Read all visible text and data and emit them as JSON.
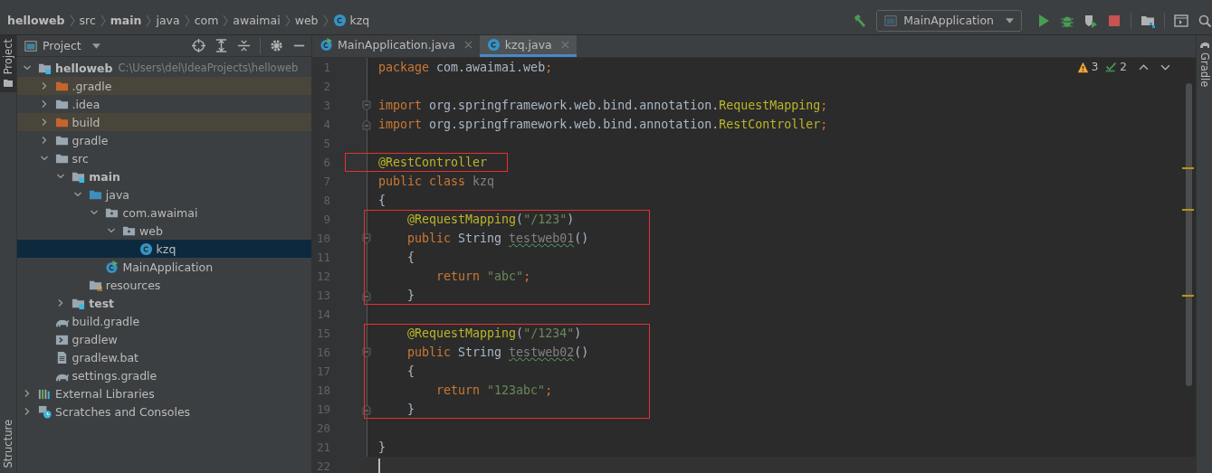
{
  "breadcrumb": [
    {
      "label": "helloweb",
      "bold": true,
      "kind": "folder"
    },
    {
      "label": "src",
      "bold": false,
      "kind": "folder"
    },
    {
      "label": "main",
      "bold": true,
      "kind": "folder"
    },
    {
      "label": "java",
      "bold": false,
      "kind": "folder"
    },
    {
      "label": "com",
      "bold": false,
      "kind": "folder"
    },
    {
      "label": "awaimai",
      "bold": false,
      "kind": "folder"
    },
    {
      "label": "web",
      "bold": false,
      "kind": "folder"
    },
    {
      "label": "kzq",
      "bold": false,
      "kind": "class"
    }
  ],
  "run_config": {
    "label": "MainApplication"
  },
  "side_tabs_left": [
    {
      "label": "Project",
      "selected": true
    },
    {
      "label": "Structure",
      "selected": false
    }
  ],
  "side_tabs_right": [
    {
      "label": "Gradle",
      "selected": false
    }
  ],
  "project_panel": {
    "title": "Project",
    "tree": [
      {
        "label": "helloweb",
        "path": "C:\\Users\\del\\IdeaProjects\\helloweb",
        "kind": "module",
        "bold": true,
        "expanded": true,
        "excluded": false,
        "selected": false,
        "children": [
          {
            "label": ".gradle",
            "kind": "excluded-folder",
            "bold": false,
            "expanded": false,
            "excluded": true,
            "selected": false
          },
          {
            "label": ".idea",
            "kind": "folder",
            "bold": false,
            "expanded": false,
            "excluded": false,
            "selected": false
          },
          {
            "label": "build",
            "kind": "excluded-folder",
            "bold": false,
            "expanded": false,
            "excluded": true,
            "selected": false
          },
          {
            "label": "gradle",
            "kind": "folder",
            "bold": false,
            "expanded": false,
            "excluded": false,
            "selected": false
          },
          {
            "label": "src",
            "kind": "folder",
            "bold": false,
            "expanded": true,
            "excluded": false,
            "selected": false,
            "children": [
              {
                "label": "main",
                "kind": "module",
                "bold": true,
                "expanded": true,
                "excluded": false,
                "selected": false,
                "children": [
                  {
                    "label": "java",
                    "kind": "source-folder",
                    "bold": false,
                    "expanded": true,
                    "excluded": false,
                    "selected": false,
                    "children": [
                      {
                        "label": "com.awaimai",
                        "kind": "package",
                        "bold": false,
                        "expanded": true,
                        "excluded": false,
                        "selected": false,
                        "children": [
                          {
                            "label": "web",
                            "kind": "package",
                            "bold": false,
                            "expanded": true,
                            "excluded": false,
                            "selected": false,
                            "children": [
                              {
                                "label": "kzq",
                                "kind": "class",
                                "bold": false,
                                "excluded": false,
                                "selected": true
                              }
                            ]
                          }
                        ]
                      },
                      {
                        "label": "MainApplication",
                        "kind": "main-class",
                        "bold": false,
                        "excluded": false,
                        "selected": false
                      }
                    ]
                  },
                  {
                    "label": "resources",
                    "kind": "resources-folder",
                    "bold": false,
                    "excluded": false,
                    "selected": false
                  }
                ]
              },
              {
                "label": "test",
                "kind": "module",
                "bold": true,
                "expanded": false,
                "excluded": false,
                "selected": false
              }
            ]
          },
          {
            "label": "build.gradle",
            "kind": "gradle",
            "bold": false,
            "excluded": false,
            "selected": false
          },
          {
            "label": "gradlew",
            "kind": "script",
            "bold": false,
            "excluded": false,
            "selected": false
          },
          {
            "label": "gradlew.bat",
            "kind": "text-file",
            "bold": false,
            "excluded": false,
            "selected": false
          },
          {
            "label": "settings.gradle",
            "kind": "gradle",
            "bold": false,
            "excluded": false,
            "selected": false
          }
        ]
      },
      {
        "label": "External Libraries",
        "kind": "libraries",
        "bold": false,
        "expanded": false,
        "excluded": false,
        "selected": false
      },
      {
        "label": "Scratches and Consoles",
        "kind": "scratches",
        "bold": false,
        "expanded": false,
        "excluded": false,
        "selected": false
      }
    ]
  },
  "editor_tabs": [
    {
      "label": "MainApplication.java",
      "kind": "main-class",
      "selected": false
    },
    {
      "label": "kzq.java",
      "kind": "class",
      "selected": true
    }
  ],
  "inspections": {
    "warnings": "3",
    "typos": "2"
  },
  "code_blocks": [
    {
      "framed": false,
      "lines": [
        {
          "no": "1",
          "kind": "code",
          "current": false,
          "tokens": [
            {
              "kind": "keyword",
              "text": "package"
            },
            {
              "kind": "plain",
              "text": " com.awaimai.web"
            },
            {
              "kind": "keyword",
              "text": ";"
            }
          ]
        },
        {
          "no": "2",
          "kind": "code",
          "current": false
        },
        {
          "no": "3",
          "kind": "fold-start",
          "current": false,
          "tokens": [
            {
              "kind": "keyword",
              "text": "import"
            },
            {
              "kind": "plain",
              "text": " org.springframework.web.bind.annotation."
            },
            {
              "kind": "annotation",
              "text": "RequestMapping"
            },
            {
              "kind": "keyword",
              "text": ";"
            }
          ]
        },
        {
          "no": "4",
          "kind": "fold-end",
          "current": false,
          "tokens": [
            {
              "kind": "keyword",
              "text": "import"
            },
            {
              "kind": "plain",
              "text": " org.springframework.web.bind.annotation."
            },
            {
              "kind": "annotation",
              "text": "RestController"
            },
            {
              "kind": "keyword",
              "text": ";"
            }
          ]
        },
        {
          "no": "5",
          "kind": "code",
          "current": false
        }
      ]
    },
    {
      "framed": true,
      "lines": [
        {
          "no": "6",
          "kind": "code",
          "current": false,
          "tokens": [
            {
              "kind": "annotation",
              "text": "@RestController"
            }
          ]
        }
      ]
    },
    {
      "framed": false,
      "lines": [
        {
          "no": "7",
          "kind": "code",
          "current": false,
          "tokens": [
            {
              "kind": "keyword",
              "text": "public class"
            },
            {
              "kind": "unused",
              "text": " kzq"
            }
          ]
        },
        {
          "no": "8",
          "kind": "code",
          "current": false,
          "tokens": [
            {
              "kind": "plain",
              "text": "{"
            }
          ]
        }
      ]
    },
    {
      "framed": true,
      "lines": [
        {
          "no": "9",
          "kind": "code",
          "current": false,
          "tokens": [
            {
              "kind": "annotation",
              "text": "    @RequestMapping"
            },
            {
              "kind": "plain",
              "text": "("
            },
            {
              "kind": "string",
              "text": "\"/123\""
            },
            {
              "kind": "plain",
              "text": ")"
            }
          ]
        },
        {
          "no": "10",
          "kind": "fold-start",
          "current": false,
          "tokens": [
            {
              "kind": "keyword",
              "text": "    public"
            },
            {
              "kind": "plain",
              "text": " String "
            },
            {
              "kind": "typo",
              "text": "testweb01"
            },
            {
              "kind": "plain",
              "text": "()"
            }
          ]
        },
        {
          "no": "11",
          "kind": "code",
          "current": false,
          "tokens": [
            {
              "kind": "plain",
              "text": "    {"
            }
          ]
        },
        {
          "no": "12",
          "kind": "code",
          "current": false,
          "tokens": [
            {
              "kind": "keyword",
              "text": "        return"
            },
            {
              "kind": "string",
              "text": " \"abc\""
            },
            {
              "kind": "keyword",
              "text": ";"
            }
          ]
        },
        {
          "no": "13",
          "kind": "fold-end",
          "current": false,
          "tokens": [
            {
              "kind": "plain",
              "text": "    }"
            }
          ]
        }
      ]
    },
    {
      "framed": false,
      "lines": [
        {
          "no": "14",
          "kind": "code",
          "current": false
        }
      ]
    },
    {
      "framed": true,
      "lines": [
        {
          "no": "15",
          "kind": "code",
          "current": false,
          "tokens": [
            {
              "kind": "annotation",
              "text": "    @RequestMapping"
            },
            {
              "kind": "plain",
              "text": "("
            },
            {
              "kind": "string",
              "text": "\"/1234\""
            },
            {
              "kind": "plain",
              "text": ")"
            }
          ]
        },
        {
          "no": "16",
          "kind": "fold-start",
          "current": false,
          "tokens": [
            {
              "kind": "keyword",
              "text": "    public"
            },
            {
              "kind": "plain",
              "text": " String "
            },
            {
              "kind": "typo",
              "text": "testweb02"
            },
            {
              "kind": "plain",
              "text": "()"
            }
          ]
        },
        {
          "no": "17",
          "kind": "code",
          "current": false,
          "tokens": [
            {
              "kind": "plain",
              "text": "    {"
            }
          ]
        },
        {
          "no": "18",
          "kind": "code",
          "current": false,
          "tokens": [
            {
              "kind": "keyword",
              "text": "        return"
            },
            {
              "kind": "string",
              "text": " \"123abc\""
            },
            {
              "kind": "keyword",
              "text": ";"
            }
          ]
        },
        {
          "no": "19",
          "kind": "fold-end",
          "current": false,
          "tokens": [
            {
              "kind": "plain",
              "text": "    }"
            }
          ]
        }
      ]
    },
    {
      "framed": false,
      "lines": [
        {
          "no": "20",
          "kind": "code",
          "current": false
        },
        {
          "no": "21",
          "kind": "code",
          "current": false,
          "tokens": [
            {
              "kind": "plain",
              "text": "}"
            }
          ]
        },
        {
          "no": "22",
          "kind": "code",
          "current": true
        }
      ]
    }
  ]
}
